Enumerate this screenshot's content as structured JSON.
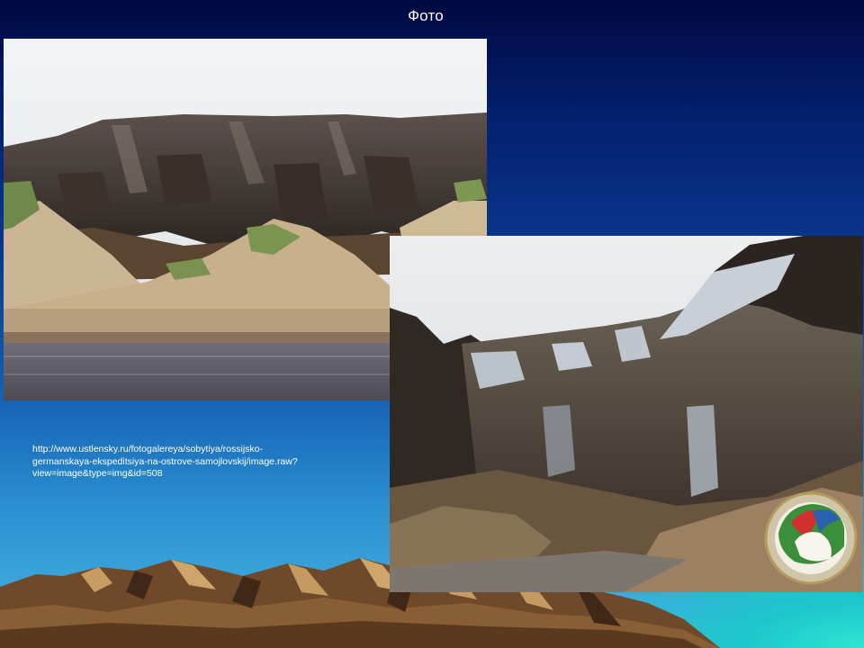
{
  "slide": {
    "title": "Фото",
    "caption_lines": [
      "http://www.ustlensky.ru/fotogalereya/sobytiya/rossijsko-",
      "germanskaya-ekspeditsiya-na-ostrove-samojlovskij/image.raw?",
      "view=image&type=img&id=508"
    ]
  },
  "photos": [
    {
      "subject": "eroded permafrost cliff above sandy riverbank and water"
    },
    {
      "subject": "ice-rich permafrost bluff with ground ice and thawing sediment"
    }
  ],
  "colors": {
    "background_top": "#00083f",
    "background_bottom": "#48b7e2",
    "accent_teal": "#2de6d4",
    "mountain_brown": "#6e4a2a",
    "text": "#ffffff"
  },
  "icons": [
    "mountain-range",
    "expedition-emblem-logo"
  ]
}
